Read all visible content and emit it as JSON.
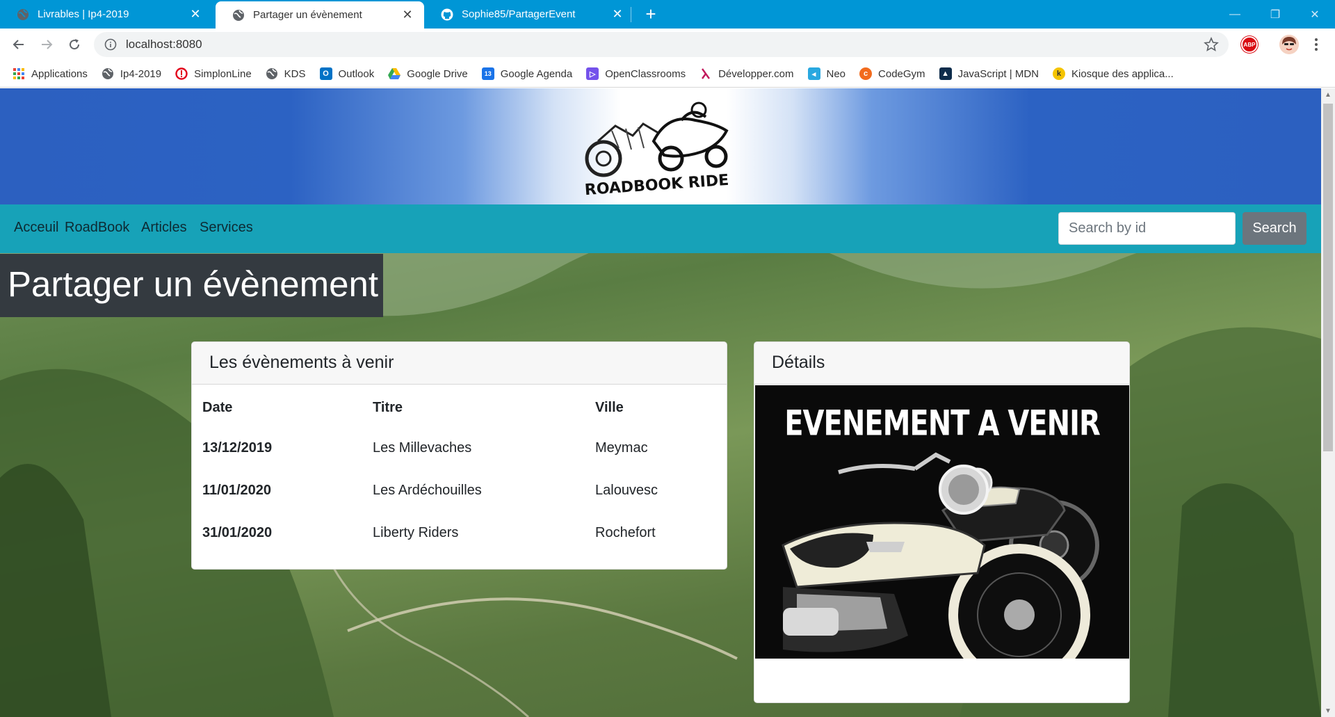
{
  "browser": {
    "tabs": [
      {
        "title": "Livrables | Ip4-2019",
        "icon": "globe-icon"
      },
      {
        "title": "Partager un évènement",
        "icon": "globe-icon"
      },
      {
        "title": "Sophie85/PartagerEvent",
        "icon": "github-icon"
      }
    ],
    "url": "localhost:8080",
    "bookmarks": [
      {
        "label": "Applications",
        "icon": "apps-grid-icon",
        "color": "#4285f4"
      },
      {
        "label": "Ip4-2019",
        "icon": "globe-icon",
        "color": "#5f6368"
      },
      {
        "label": "SimplonLine",
        "icon": "simplon-icon",
        "color": "#e2001a"
      },
      {
        "label": "KDS",
        "icon": "globe-icon",
        "color": "#5f6368"
      },
      {
        "label": "Outlook",
        "icon": "outlook-icon",
        "color": "#0072c6"
      },
      {
        "label": "Google Drive",
        "icon": "drive-icon",
        "color": "#fbbc04"
      },
      {
        "label": "Google Agenda",
        "icon": "calendar-icon",
        "color": "#1a73e8"
      },
      {
        "label": "OpenClassrooms",
        "icon": "openclassrooms-icon",
        "color": "#7451eb"
      },
      {
        "label": "Développer.com",
        "icon": "developpez-icon",
        "color": "#c2185b"
      },
      {
        "label": "Neo",
        "icon": "neo-icon",
        "color": "#29a8e0"
      },
      {
        "label": "CodeGym",
        "icon": "codegym-icon",
        "color": "#f26b1d"
      },
      {
        "label": "JavaScript | MDN",
        "icon": "mdn-icon",
        "color": "#0d2c4b"
      },
      {
        "label": "Kiosque des applica...",
        "icon": "kiosque-icon",
        "color": "#f5c400"
      }
    ]
  },
  "site": {
    "logo_text": "ROADBOOK RIDE",
    "nav": [
      "Acceuil",
      "RoadBook",
      "Articles",
      "Services"
    ],
    "search": {
      "placeholder": "Search by id",
      "button": "Search"
    },
    "page_title": "Partager un évènement"
  },
  "events": {
    "header": "Les évènements à venir",
    "columns": [
      "Date",
      "Titre",
      "Ville"
    ],
    "rows": [
      {
        "date": "13/12/2019",
        "title": "Les Millevaches",
        "city": "Meymac"
      },
      {
        "date": "11/01/2020",
        "title": "Les Ardéchouilles",
        "city": "Lalouvesc"
      },
      {
        "date": "31/01/2020",
        "title": "Liberty Riders",
        "city": "Rochefort"
      }
    ]
  },
  "details": {
    "header": "Détails",
    "image_title": "EVENEMENT A VENIR"
  },
  "colors": {
    "tabstrip": "#0096d6",
    "navbar": "#17a2b8",
    "title_bg": "#343a40",
    "search_button": "#6c757d"
  }
}
